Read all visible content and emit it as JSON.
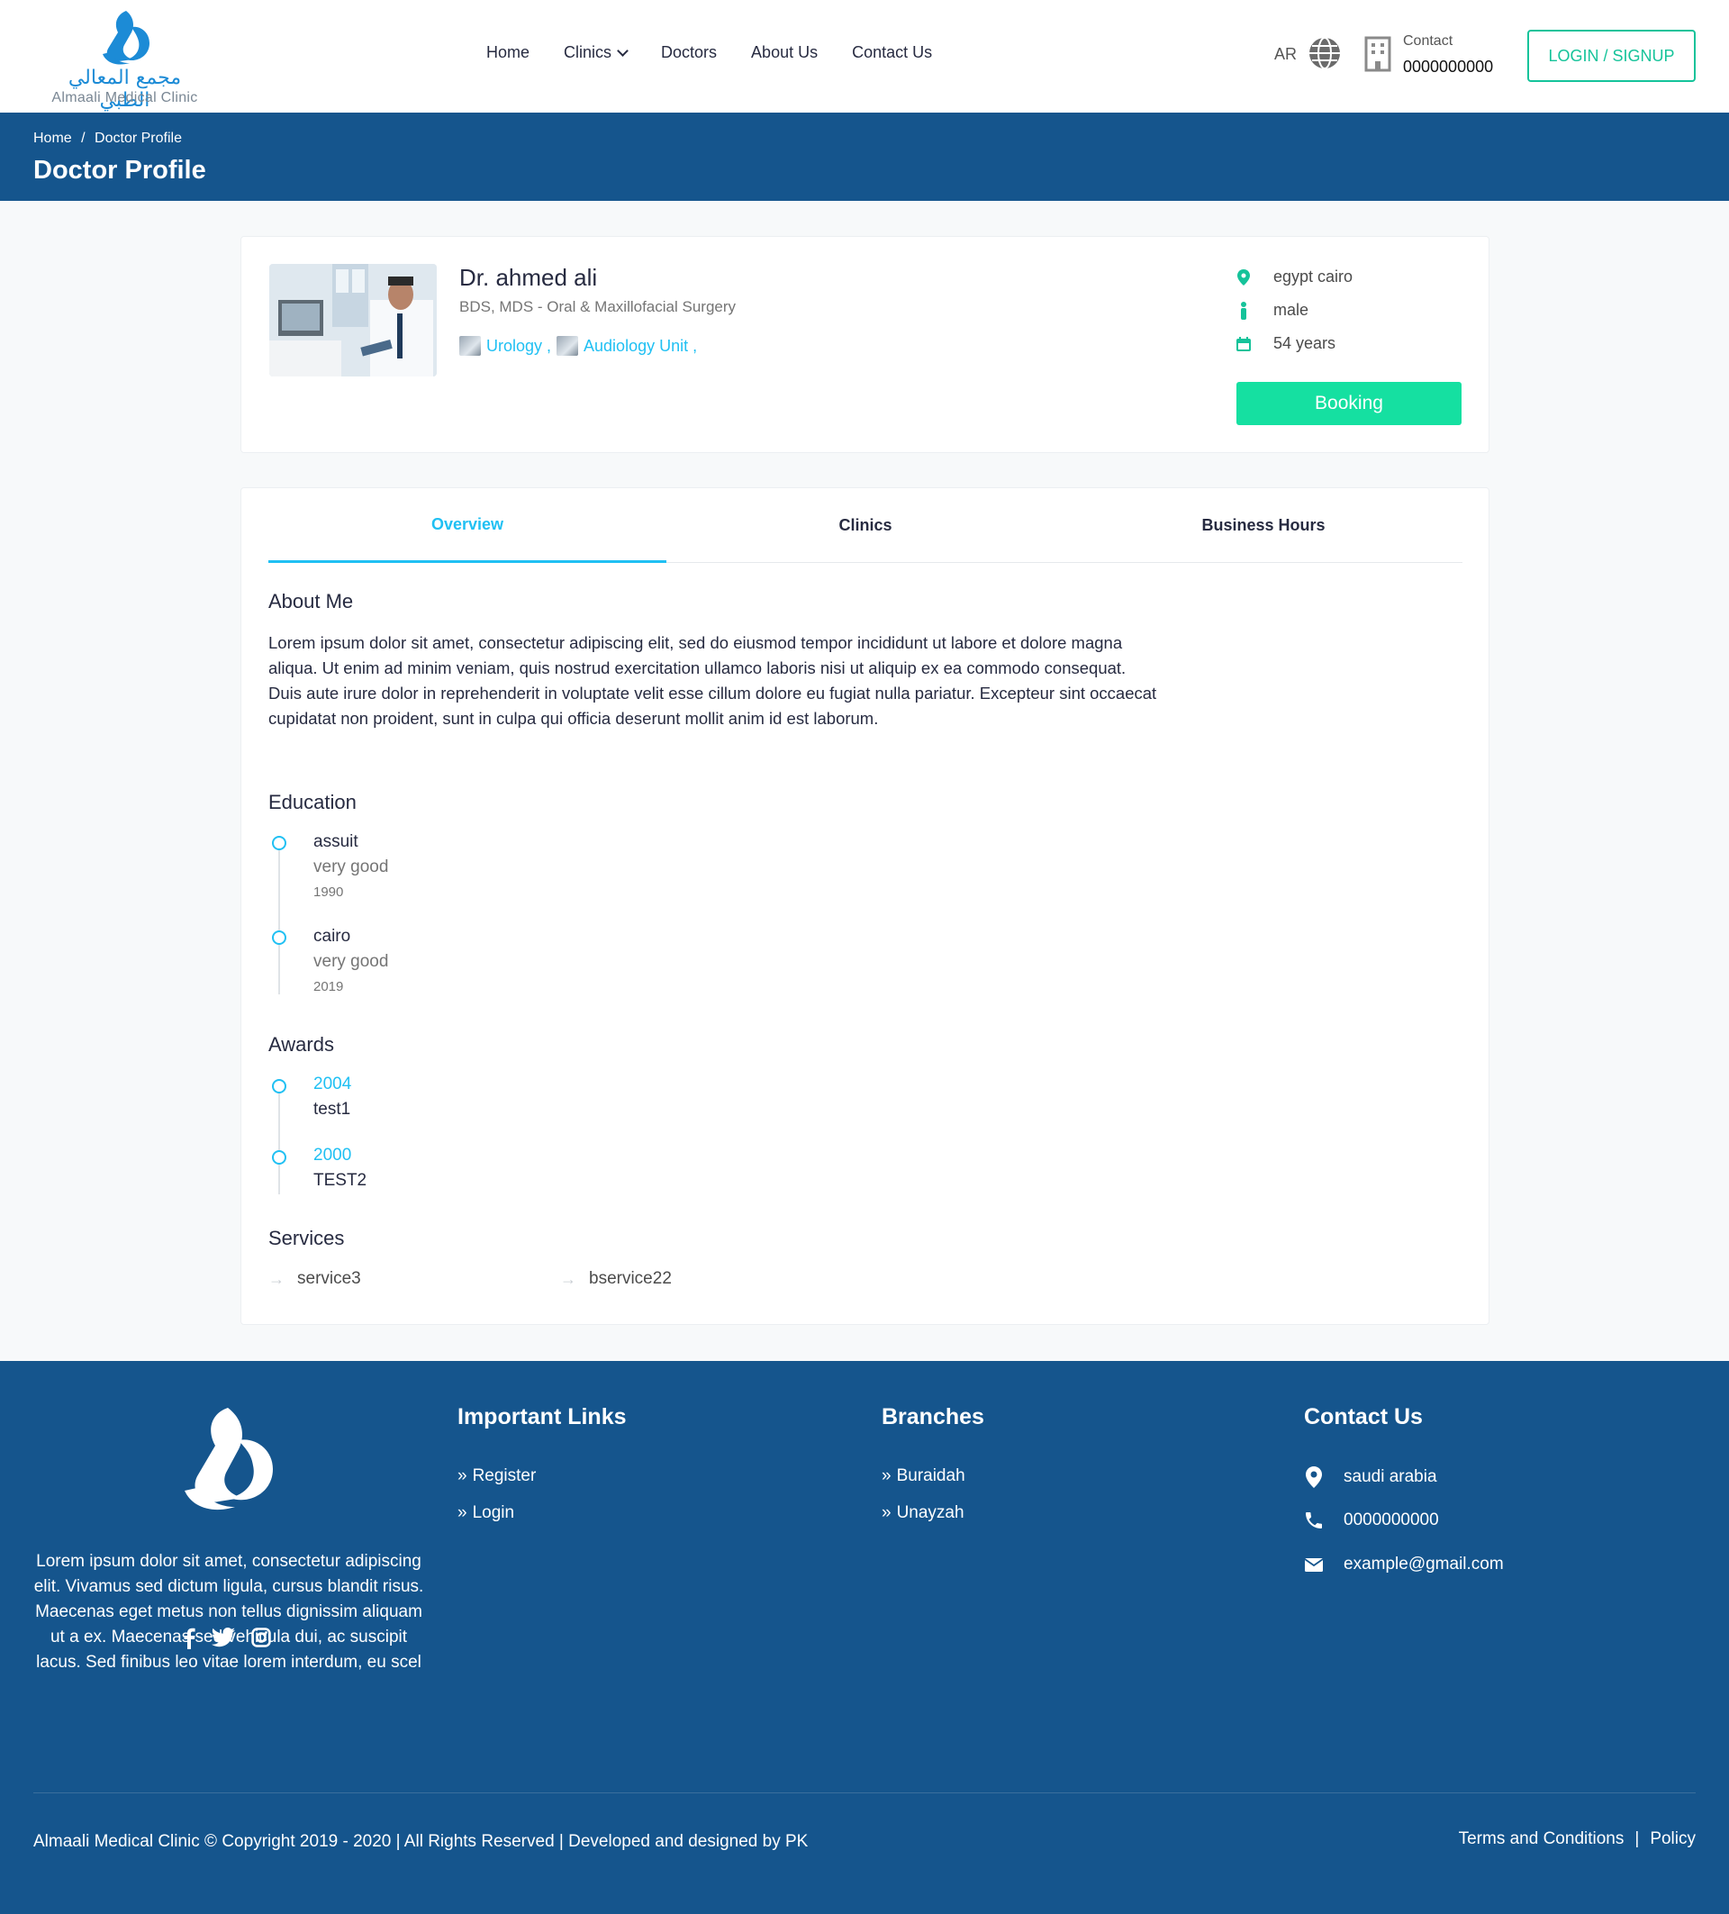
{
  "header": {
    "logo_ar": "مجمع المعالي الطبي",
    "logo_en": "Almaali Medical Clinic",
    "nav": [
      "Home",
      "Clinics",
      "Doctors",
      "About Us",
      "Contact Us"
    ],
    "lang": "AR",
    "contact_label": "Contact",
    "contact_number": "0000000000",
    "login_label": "LOGIN / SIGNUP"
  },
  "breadcrumb": {
    "home": "Home",
    "separator": "/",
    "current": "Doctor Profile",
    "title": "Doctor Profile"
  },
  "doctor": {
    "name": "Dr. ahmed ali",
    "degree": "BDS, MDS - Oral & Maxillofacial Surgery",
    "specialities": [
      "Urology ,",
      "Audiology Unit ,"
    ],
    "location": "egypt cairo",
    "gender": "male",
    "age": "54 years",
    "booking_label": "Booking"
  },
  "tabs": [
    "Overview",
    "Clinics",
    "Business Hours"
  ],
  "overview": {
    "about_title": "About Me",
    "about_text": "Lorem ipsum dolor sit amet, consectetur adipiscing elit, sed do eiusmod tempor incididunt ut labore et dolore magna aliqua. Ut enim ad minim veniam, quis nostrud exercitation ullamco laboris nisi ut aliquip ex ea commodo consequat. Duis aute irure dolor in reprehenderit in voluptate velit esse cillum dolore eu fugiat nulla pariatur. Excepteur sint occaecat cupidatat non proident, sunt in culpa qui officia deserunt mollit anim id est laborum.",
    "education_title": "Education",
    "education": [
      {
        "school": "assuit",
        "grade": "very good",
        "year": "1990"
      },
      {
        "school": "cairo",
        "grade": "very good",
        "year": "2019"
      }
    ],
    "awards_title": "Awards",
    "awards": [
      {
        "year": "2004",
        "name": "test1"
      },
      {
        "year": "2000",
        "name": "TEST2"
      }
    ],
    "services_title": "Services",
    "services": [
      "service3",
      "bservice22"
    ]
  },
  "footer": {
    "about": "Lorem ipsum dolor sit amet, consectetur adipiscing elit. Vivamus sed dictum ligula, cursus blandit risus. Maecenas eget metus non tellus dignissim aliquam ut a ex. Maecenas sed vehicula dui, ac suscipit lacus. Sed finibus leo vitae lorem interdum, eu scel",
    "links_title": "Important Links",
    "links": [
      "Register",
      "Login"
    ],
    "branches_title": "Branches",
    "branches": [
      "Buraidah",
      "Unayzah"
    ],
    "contact_title": "Contact Us",
    "contact_address": "saudi arabia",
    "contact_phone": "0000000000",
    "contact_email": "example@gmail.com",
    "copyright": "Almaali Medical Clinic © Copyright 2019 - 2020 | All Rights Reserved | Developed and designed by PK",
    "terms": "Terms and Conditions",
    "legal_sep": "|",
    "policy": "Policy"
  },
  "colors": {
    "brand_blue": "#15558d",
    "accent_cyan": "#20c0f3",
    "accent_green": "#15e0a1"
  }
}
